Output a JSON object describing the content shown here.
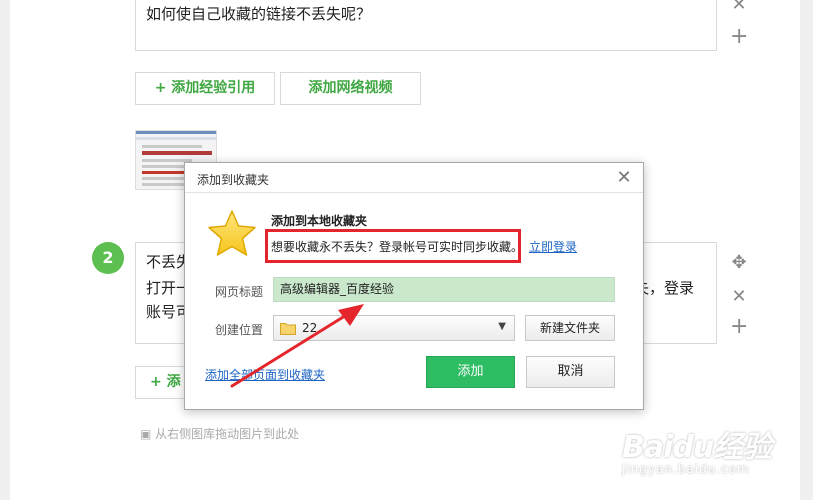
{
  "background_editor": {
    "step1_text": "如何使自己收藏的链接不丢失呢？",
    "ref_buttons": {
      "add_reference": "添加经验引用",
      "add_video": "添加网络视频",
      "plus_glyph": "+"
    },
    "step2": {
      "number": "2",
      "line1": "不丢失",
      "line2_left": "打开一",
      "line2_right": "失，登录",
      "line3": "账号可"
    },
    "step3_button": "添",
    "image_hint": "从右侧图库拖动图片到此处"
  },
  "dialog": {
    "title": "添加到收藏夹",
    "heading": "添加到本地收藏夹",
    "description": "想要收藏永不丢失？登录帐号可实时同步收藏。",
    "login_link": "立即登录",
    "webpage_title_label": "网页标题",
    "webpage_title_value": "高级编辑器_百度经验",
    "location_label": "创建位置",
    "folder_value": "22",
    "new_folder_button": "新建文件夹",
    "add_all_link": "添加全部页面到收藏夹",
    "add_button": "添加",
    "cancel_button": "取消"
  },
  "watermark": {
    "logo": "Baidu经验",
    "url": "jingyan.baidu.com"
  },
  "colors": {
    "accent_green": "#2fbd64",
    "step_green": "#5cbf4f",
    "highlight_red": "#e4262c",
    "link_blue": "#1d64c4",
    "input_green": "#c9e8cc"
  },
  "icons": {
    "close": "close-icon",
    "star": "star-icon",
    "folder": "folder-icon",
    "move": "move-icon",
    "plus": "plus-icon",
    "image": "image-icon"
  }
}
